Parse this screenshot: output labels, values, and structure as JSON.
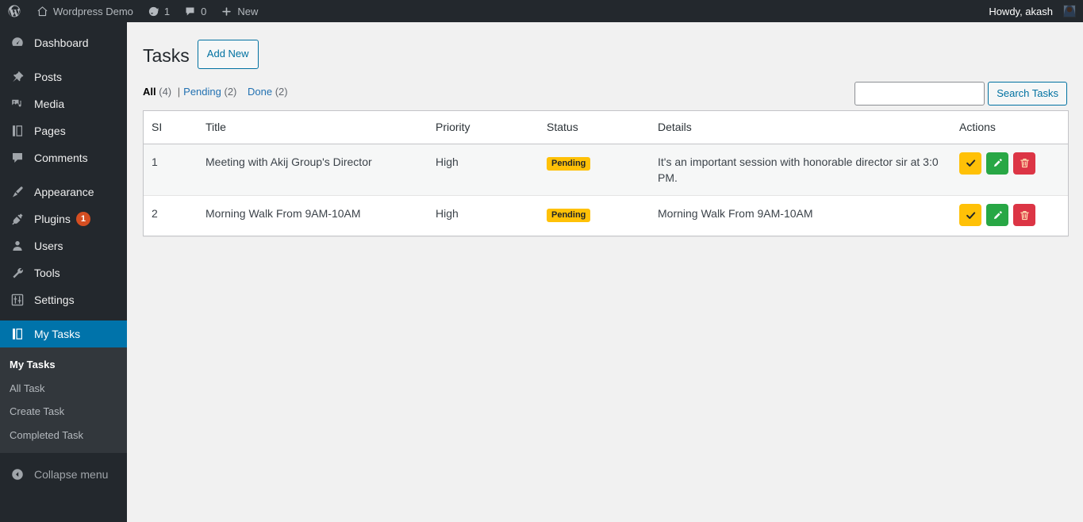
{
  "adminbar": {
    "logo_icon": "wordpress-logo-icon",
    "site": {
      "label": "Wordpress Demo",
      "icon": "home-icon"
    },
    "updates": {
      "count": "1",
      "icon": "updates-icon"
    },
    "comments": {
      "count": "0",
      "icon": "comment-bubble-icon"
    },
    "new": {
      "label": "New",
      "icon": "plus-icon"
    },
    "howdy": "Howdy, akash",
    "avatar_icon": "user-avatar"
  },
  "sidebar": {
    "items": [
      {
        "label": "Dashboard",
        "icon": "dashboard-icon",
        "name": "dashboard",
        "sep_after": true
      },
      {
        "label": "Posts",
        "icon": "pin-icon",
        "name": "posts"
      },
      {
        "label": "Media",
        "icon": "media-icon",
        "name": "media"
      },
      {
        "label": "Pages",
        "icon": "pages-icon",
        "name": "pages"
      },
      {
        "label": "Comments",
        "icon": "comment-icon",
        "name": "comments",
        "sep_after": true
      },
      {
        "label": "Appearance",
        "icon": "appearance-brush-icon",
        "name": "appearance"
      },
      {
        "label": "Plugins",
        "icon": "plugins-plug-icon",
        "name": "plugins",
        "badge": "1"
      },
      {
        "label": "Users",
        "icon": "users-icon",
        "name": "users"
      },
      {
        "label": "Tools",
        "icon": "tools-wrench-icon",
        "name": "tools"
      },
      {
        "label": "Settings",
        "icon": "settings-sliders-icon",
        "name": "settings",
        "sep_after": true
      },
      {
        "label": "My Tasks",
        "icon": "my-tasks-icon",
        "name": "my-tasks",
        "current": true
      }
    ],
    "submenu": {
      "heading": "My Tasks",
      "items": [
        {
          "label": "All Task",
          "name": "all-task"
        },
        {
          "label": "Create Task",
          "name": "create-task"
        },
        {
          "label": "Completed Task",
          "name": "completed-task"
        }
      ]
    },
    "collapse": {
      "label": "Collapse menu",
      "icon": "collapse-arrow-icon"
    },
    "active_color": "#0073aa",
    "badge_color": "#d54e21"
  },
  "page": {
    "title": "Tasks",
    "add_new_label": "Add New",
    "filters": [
      {
        "label": "All",
        "count": "(4)",
        "current": true,
        "divider_after": true
      },
      {
        "label": "Pending",
        "count": "(2)",
        "current": false,
        "divider_after": false
      },
      {
        "label": "Done",
        "count": "(2)",
        "current": false,
        "divider_after": false
      }
    ],
    "search": {
      "value": "",
      "placeholder": "",
      "button_label": "Search Tasks"
    }
  },
  "table": {
    "columns": [
      "SI",
      "Title",
      "Priority",
      "Status",
      "Details",
      "Actions"
    ],
    "rows": [
      {
        "sl": "1",
        "title": "Meeting with Akij Group's Director",
        "priority": "High",
        "status": "Pending",
        "status_type": "pending",
        "details": "It's an important session with honorable director sir at 3:0 PM."
      },
      {
        "sl": "2",
        "title": "Morning Walk From 9AM-10AM",
        "priority": "High",
        "status": "Pending",
        "status_type": "pending",
        "details": "Morning Walk From 9AM-10AM"
      }
    ],
    "actions": {
      "done": {
        "icon": "check-icon",
        "color": "#ffc107"
      },
      "edit": {
        "icon": "pencil-icon",
        "color": "#28a745"
      },
      "delete": {
        "icon": "trash-icon",
        "color": "#dc3545"
      }
    }
  }
}
